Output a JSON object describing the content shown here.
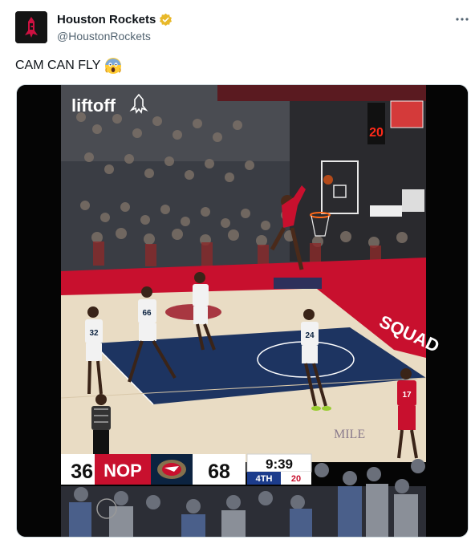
{
  "author": {
    "display_name": "Houston Rockets",
    "handle": "@HoustonRockets",
    "verified_badge_icon": "gold-verified-badge-icon",
    "avatar_icon": "rockets-logo-icon"
  },
  "tweet": {
    "text": "CAM CAN FLY",
    "emoji_icon": "face-screaming-in-fear-icon",
    "timestamp": ""
  },
  "media": {
    "watermark": "liftoff",
    "shot_clock": "20",
    "court_banner": "SQUAD",
    "scoreboard": {
      "home_score": "36",
      "away_team": "NOP",
      "away_score": "68",
      "game_clock": "9:39",
      "quarter": "4TH",
      "shot_clock": "20"
    },
    "jerseys": [
      "32",
      "66",
      "24",
      "17"
    ]
  },
  "colors": {
    "rockets_red": "#ce1141",
    "pelicans_navy": "#0c2340",
    "badge_gold": "#e8b829",
    "handle_gray": "#536471"
  }
}
